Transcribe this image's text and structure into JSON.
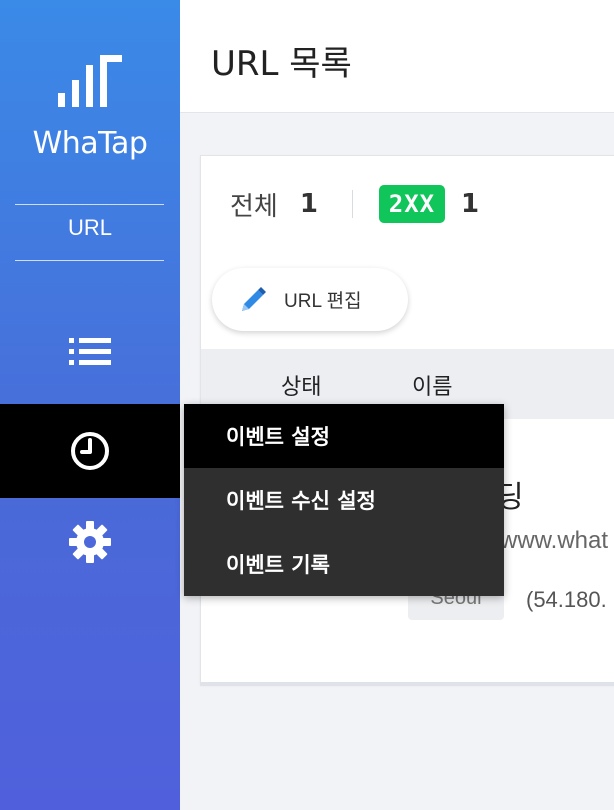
{
  "app": {
    "brand": "WhaTap",
    "section_label": "URL"
  },
  "header": {
    "title": "URL 목록"
  },
  "summary": {
    "total_label": "전체",
    "total_count": "1",
    "status_badge": "2XX",
    "status_count": "1"
  },
  "toolbar": {
    "edit_label": "URL 편집"
  },
  "table": {
    "columns": [
      "상태",
      "이름"
    ],
    "rows": [
      {
        "name": "딩",
        "url": "www.what",
        "location": "Seoul",
        "ip": "(54.180."
      }
    ]
  },
  "menu": {
    "items": [
      {
        "label": "이벤트 설정"
      },
      {
        "label": "이벤트 수신 설정"
      },
      {
        "label": "이벤트 기록"
      }
    ]
  },
  "colors": {
    "sidebar_top": "#3a8ae8",
    "sidebar_bottom": "#5060dc",
    "badge_green": "#10c55a",
    "menu_bg": "#2f2f2f",
    "menu_active": "#000000"
  },
  "icons": {
    "sidebar": [
      "list-icon",
      "clock-icon",
      "gear-icon"
    ],
    "toolbar": "pencil-icon"
  }
}
